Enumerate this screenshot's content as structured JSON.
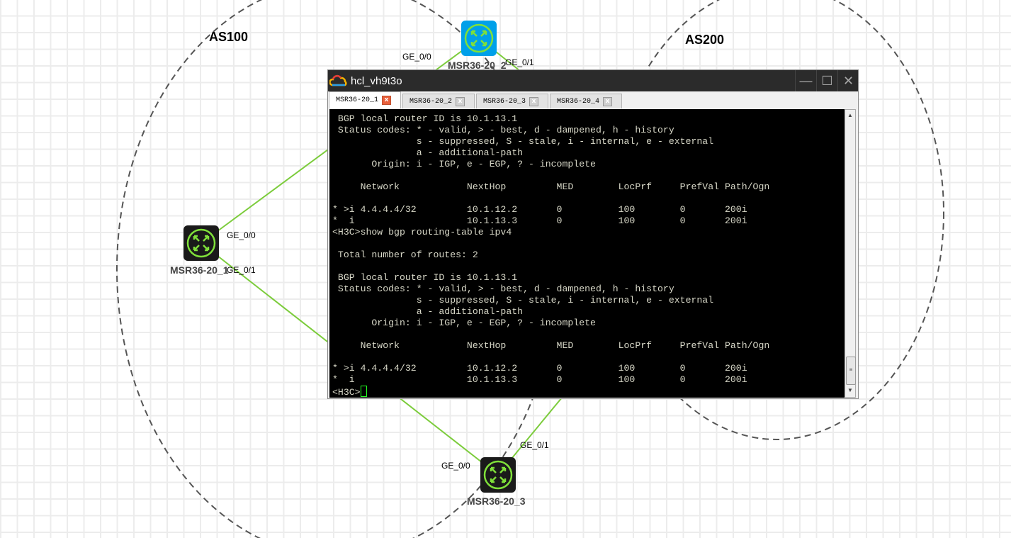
{
  "topology": {
    "areas": [
      {
        "label": "AS100"
      },
      {
        "label": "AS200"
      }
    ],
    "routers": [
      {
        "name": "MSR36-20_1",
        "color": "#1a1a1a",
        "ports": [
          "GE_0/0",
          "GE_0/1"
        ]
      },
      {
        "name": "MSR36-20_2",
        "color": "#00a0e9",
        "ports": [
          "GE_0/0",
          "GE_0/1"
        ]
      },
      {
        "name": "MSR36-20_3",
        "color": "#1a1a1a",
        "ports": [
          "GE_0/0",
          "GE_0/1"
        ]
      }
    ],
    "link_color": "#7ccc3c"
  },
  "terminal": {
    "title": "hcl_vh9t3o",
    "controls": {
      "minimize": "—",
      "maximize": "☐",
      "close": "✕"
    },
    "tabs": [
      {
        "label": "MSR36-20_1"
      },
      {
        "label": "MSR36-20_2"
      },
      {
        "label": "MSR36-20_3"
      },
      {
        "label": "MSR36-20_4"
      }
    ],
    "lines": [
      " BGP local router ID is 10.1.13.1",
      " Status codes: * - valid, > - best, d - dampened, h - history",
      "               s - suppressed, S - stale, i - internal, e - external",
      "               a - additional-path",
      "       Origin: i - IGP, e - EGP, ? - incomplete",
      "",
      "     Network            NextHop         MED        LocPrf     PrefVal Path/Ogn",
      "",
      "* >i 4.4.4.4/32         10.1.12.2       0          100        0       200i",
      "*  i                    10.1.13.3       0          100        0       200i",
      "<H3C>show bgp routing-table ipv4",
      "",
      " Total number of routes: 2",
      "",
      " BGP local router ID is 10.1.13.1",
      " Status codes: * - valid, > - best, d - dampened, h - history",
      "               s - suppressed, S - stale, i - internal, e - external",
      "               a - additional-path",
      "       Origin: i - IGP, e - EGP, ? - incomplete",
      "",
      "     Network            NextHop         MED        LocPrf     PrefVal Path/Ogn",
      "",
      "* >i 4.4.4.4/32         10.1.12.2       0          100        0       200i",
      "*  i                    10.1.13.3       0          100        0       200i"
    ],
    "prompt": "<H3C>"
  }
}
